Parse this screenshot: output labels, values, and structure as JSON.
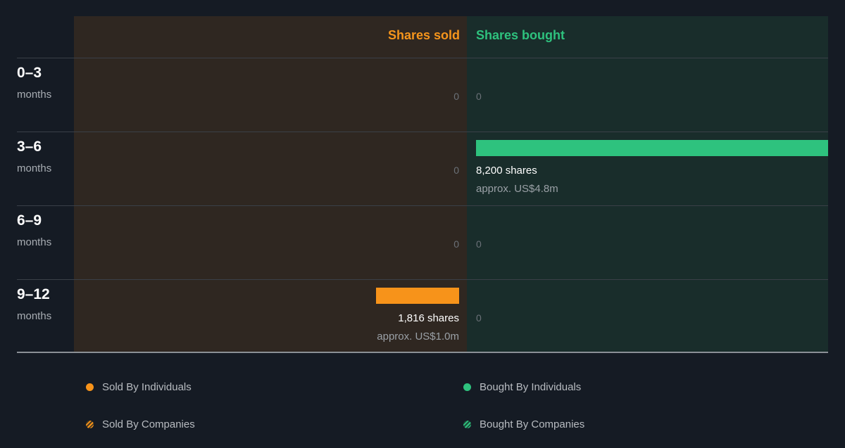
{
  "chart_data": {
    "type": "bar",
    "headers": {
      "sold": "Shares sold",
      "bought": "Shares bought"
    },
    "periods": [
      {
        "range": "0–3",
        "unit": "months",
        "sold": 0,
        "bought": 0,
        "sold_zero": "0",
        "bought_zero": "0"
      },
      {
        "range": "3–6",
        "unit": "months",
        "sold": 0,
        "bought": 8200,
        "sold_zero": "0",
        "bought_label": "8,200 shares",
        "bought_approx": "approx. US$4.8m"
      },
      {
        "range": "6–9",
        "unit": "months",
        "sold": 0,
        "bought": 0,
        "sold_zero": "0",
        "bought_zero": "0"
      },
      {
        "range": "9–12",
        "unit": "months",
        "sold": 1816,
        "bought": 0,
        "sold_label": "1,816 shares",
        "sold_approx": "approx. US$1.0m",
        "bought_zero": "0"
      }
    ],
    "sold_max": 8200,
    "bought_max": 8200,
    "legend": [
      {
        "label": "Sold By Individuals",
        "color": "#f7931a",
        "icon": "dot"
      },
      {
        "label": "Bought By Individuals",
        "color": "#2ec27e",
        "icon": "dot"
      },
      {
        "label": "Sold By Companies",
        "color": "#f7931a",
        "icon": "striped-dot"
      },
      {
        "label": "Bought By Companies",
        "color": "#2ec27e",
        "icon": "striped-dot"
      }
    ]
  },
  "colors": {
    "sold": "#f7931a",
    "bought": "#2ec27e",
    "background": "#151b24"
  }
}
